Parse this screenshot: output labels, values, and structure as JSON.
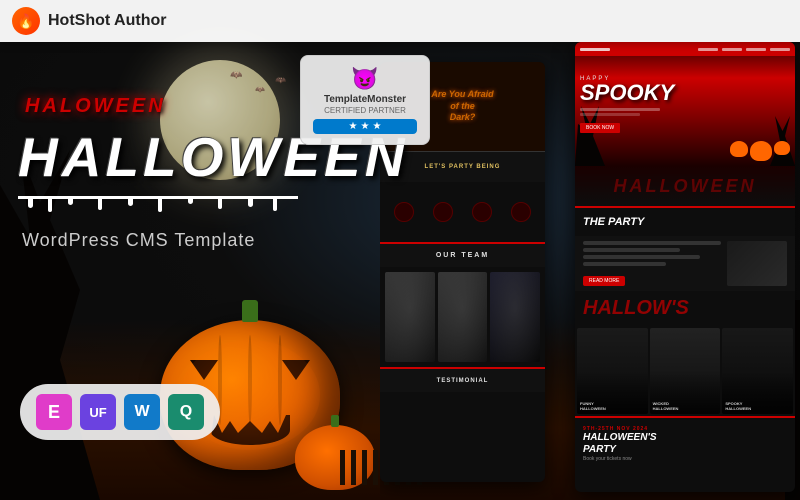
{
  "header": {
    "title": "HotShot Author",
    "logo_emoji": "🔥"
  },
  "tm_badge": {
    "icon": "😈",
    "name": "TemplateMonster",
    "certified": "CERTIFIED PARTNER",
    "stars": [
      "★",
      "★",
      "★"
    ]
  },
  "main": {
    "halloween_small": "HALOWEEN",
    "halloween_large": "HALLOWEEN",
    "subtitle": "WordPress CMS Template"
  },
  "plugins": [
    {
      "name": "Elementor",
      "letter": "E",
      "color": "#e03cc9"
    },
    {
      "name": "UF",
      "letter": "UF",
      "color": "#6b42e0"
    },
    {
      "name": "WordPress",
      "letter": "W",
      "color": "#117ac9"
    },
    {
      "name": "Quix",
      "letter": "Q",
      "color": "#1a8c6e"
    }
  ],
  "preview_left": {
    "hero_text": "Are You Afraid\nof the\nDark?",
    "party_label": "LET'S PARTY BEING",
    "team_label": "OUR TEAM",
    "testimonial_label": "TESTIMONIAL"
  },
  "preview_right": {
    "happy": "HAPPY",
    "spooky": "SPOOKY",
    "halloween": "HALLOWEEN",
    "the_party": "THE PARTY",
    "hallows": "HALLOW'S",
    "event_labels": [
      "FUNNY\nHALLOWEEN",
      "WICKED\nHALLOWEEN",
      "SPOOKY\nHALLOWEEN"
    ],
    "party_date": "9TH-25TH NOV 2024",
    "party_title": "HALLOWEEN'S\nPARTY",
    "party_sub": "Book your tickets now"
  }
}
